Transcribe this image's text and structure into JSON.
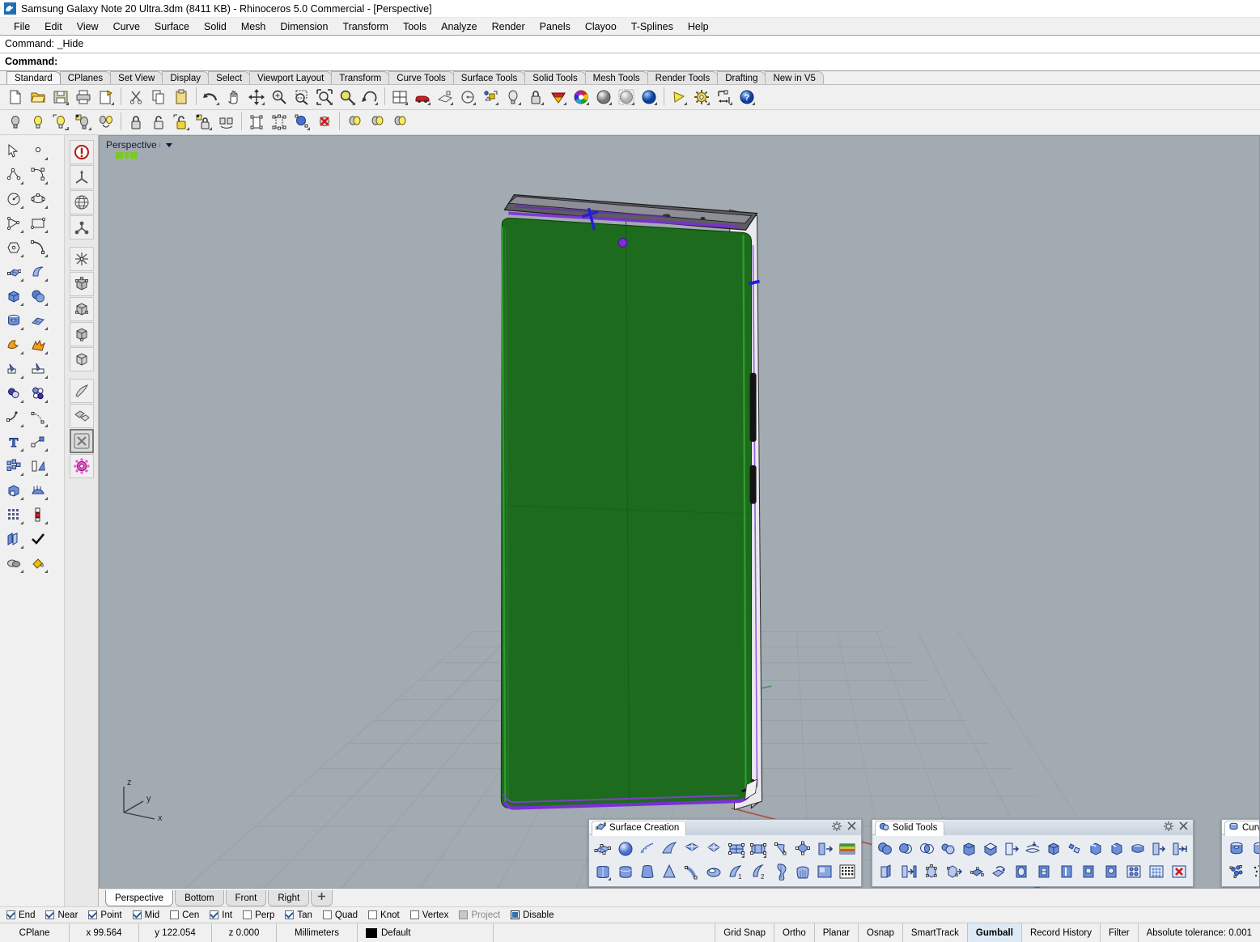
{
  "window": {
    "title": "Samsung Galaxy Note 20 Ultra.3dm (8411 KB) - Rhinoceros 5.0 Commercial - [Perspective]",
    "icon": "rhino-app-icon"
  },
  "menubar": {
    "items": [
      {
        "label": "File"
      },
      {
        "label": "Edit"
      },
      {
        "label": "View"
      },
      {
        "label": "Curve"
      },
      {
        "label": "Surface"
      },
      {
        "label": "Solid"
      },
      {
        "label": "Mesh"
      },
      {
        "label": "Dimension"
      },
      {
        "label": "Transform"
      },
      {
        "label": "Tools"
      },
      {
        "label": "Analyze"
      },
      {
        "label": "Render"
      },
      {
        "label": "Panels"
      },
      {
        "label": "Clayoo"
      },
      {
        "label": "T-Splines"
      },
      {
        "label": "Help"
      }
    ]
  },
  "command": {
    "history": "Command: _Hide",
    "prompt": "Command:",
    "input_value": ""
  },
  "toolbar_tabs": {
    "active": "Standard",
    "items": [
      {
        "label": "Standard"
      },
      {
        "label": "CPlanes"
      },
      {
        "label": "Set View"
      },
      {
        "label": "Display"
      },
      {
        "label": "Select"
      },
      {
        "label": "Viewport Layout"
      },
      {
        "label": "Transform"
      },
      {
        "label": "Curve Tools"
      },
      {
        "label": "Surface Tools"
      },
      {
        "label": "Solid Tools"
      },
      {
        "label": "Mesh Tools"
      },
      {
        "label": "Render Tools"
      },
      {
        "label": "Drafting"
      },
      {
        "label": "New in V5"
      }
    ]
  },
  "standard_toolbar": {
    "buttons": [
      {
        "name": "new-file-icon"
      },
      {
        "name": "open-file-icon"
      },
      {
        "name": "save-file-icon"
      },
      {
        "name": "print-icon"
      },
      {
        "name": "copy-to-clipboard-icon"
      },
      {
        "name": "cut-icon"
      },
      {
        "name": "copy-icon"
      },
      {
        "name": "paste-icon"
      },
      {
        "name": "undo-icon"
      },
      {
        "name": "pan-hand-icon"
      },
      {
        "name": "move-icon"
      },
      {
        "name": "zoom-in-icon"
      },
      {
        "name": "zoom-window-icon"
      },
      {
        "name": "zoom-extents-icon"
      },
      {
        "name": "zoom-selected-icon"
      },
      {
        "name": "rotate-view-icon"
      },
      {
        "name": "four-viewport-icon"
      },
      {
        "name": "render-car-icon"
      },
      {
        "name": "shade-icon"
      },
      {
        "name": "circle-tool-icon"
      },
      {
        "name": "named-cplane-icon"
      },
      {
        "name": "layer-bulb-icon"
      },
      {
        "name": "lock-icon"
      },
      {
        "name": "layers-panel-icon"
      },
      {
        "name": "color-wheel-icon"
      },
      {
        "name": "shaded-sphere-icon"
      },
      {
        "name": "ghosted-sphere-icon"
      },
      {
        "name": "rendered-sphere-icon"
      },
      {
        "name": "light-cone-icon"
      },
      {
        "name": "options-gear-icon"
      },
      {
        "name": "dimension-icon"
      },
      {
        "name": "help-icon"
      }
    ]
  },
  "layer_toolbar": {
    "buttons": [
      {
        "name": "layer-off-icon"
      },
      {
        "name": "layer-on-icon"
      },
      {
        "name": "layer-on-selected-icon"
      },
      {
        "name": "layer-toggle-icon"
      },
      {
        "name": "layer-isolate-icon"
      },
      {
        "name": "lock-layer-icon"
      },
      {
        "name": "unlock-layer-icon"
      },
      {
        "name": "unlock-selected-icon"
      },
      {
        "name": "lock-toggle-icon"
      },
      {
        "name": "swap-lock-icon"
      },
      {
        "name": "select-objects-icon"
      },
      {
        "name": "select-points-icon"
      },
      {
        "name": "select-sublayer-icon"
      },
      {
        "name": "deselect-all-icon"
      },
      {
        "name": "light-a-icon"
      },
      {
        "name": "light-b-icon"
      },
      {
        "name": "light-c-icon"
      }
    ]
  },
  "left_sidebar": {
    "buttons": [
      {
        "name": "select-arrow-icon"
      },
      {
        "name": "point-object-icon"
      },
      {
        "name": "polyline-icon"
      },
      {
        "name": "control-point-curve-icon"
      },
      {
        "name": "circle-icon"
      },
      {
        "name": "ellipse-icon"
      },
      {
        "name": "polygon-icon"
      },
      {
        "name": "rectangle-icon"
      },
      {
        "name": "hexagon-icon"
      },
      {
        "name": "arc-icon"
      },
      {
        "name": "surface-from-points-icon"
      },
      {
        "name": "loft-surface-icon"
      },
      {
        "name": "box-icon"
      },
      {
        "name": "sphere-icon"
      },
      {
        "name": "cylinder-icon"
      },
      {
        "name": "planar-surface-icon"
      },
      {
        "name": "boolean-union-icon"
      },
      {
        "name": "explode-icon"
      },
      {
        "name": "trim-icon"
      },
      {
        "name": "split-icon"
      },
      {
        "name": "fillet-icon"
      },
      {
        "name": "chamfer-icon"
      },
      {
        "name": "offset-curve-icon"
      },
      {
        "name": "blend-curve-icon"
      },
      {
        "name": "text-object-icon"
      },
      {
        "name": "scale-icon"
      },
      {
        "name": "array-icon"
      },
      {
        "name": "mirror-icon"
      },
      {
        "name": "extrude-icon"
      },
      {
        "name": "sweep-icon"
      },
      {
        "name": "rectangular-array-icon"
      },
      {
        "name": "polar-array-icon"
      },
      {
        "name": "copy-object-icon"
      },
      {
        "name": "check-object-icon"
      },
      {
        "name": "boolean-difference-icon"
      },
      {
        "name": "paint-bucket-icon"
      }
    ]
  },
  "second_sidebar": {
    "groups": [
      {
        "buttons": [
          {
            "name": "tspline-convert-icon"
          },
          {
            "name": "tspline-axis-icon"
          },
          {
            "name": "tspline-globe-icon"
          },
          {
            "name": "tspline-node-icon"
          }
        ]
      },
      {
        "buttons": [
          {
            "name": "tspline-symmetry-icon"
          },
          {
            "name": "tspline-box-a-icon"
          },
          {
            "name": "tspline-box-b-icon"
          },
          {
            "name": "tspline-box-c-icon"
          },
          {
            "name": "tspline-box-d-icon"
          }
        ]
      },
      {
        "buttons": [
          {
            "name": "tspline-pull-icon"
          },
          {
            "name": "tspline-bridge-icon"
          },
          {
            "name": "tspline-toggle-box-icon"
          },
          {
            "name": "clayoo-gear-icon"
          }
        ]
      }
    ]
  },
  "viewport": {
    "label": "Perspective",
    "dropdown_icon": "chevron-down-icon",
    "background_color": "#a2aab2",
    "grid_color": "#9aa2aa",
    "axis_x_color": "#c0392b",
    "axis_y_color": "#2e8b3f",
    "axes": {
      "x": "x",
      "y": "y",
      "z": "z"
    },
    "model": {
      "name": "samsung-galaxy-note-20-ultra-model",
      "screen_color": "#1d6b1d",
      "edge_highlight_color": "#7b2fd4",
      "frame_color": "#e9e9ee",
      "selected_edge_color": "#2020d8"
    }
  },
  "viewport_tabs": {
    "active": "Perspective",
    "items": [
      {
        "label": "Perspective"
      },
      {
        "label": "Bottom"
      },
      {
        "label": "Front"
      },
      {
        "label": "Right"
      }
    ],
    "add_label": "+"
  },
  "float_panels": [
    {
      "name": "surface-creation-panel",
      "title": "Surface Creation",
      "icon": "surface-panel-icon",
      "gear_icon": "gear-icon",
      "close_icon": "close-icon",
      "rows": [
        [
          {
            "name": "surface-from-points-icon"
          },
          {
            "name": "sphere-surface-icon"
          },
          {
            "name": "surface-from-curves-icon"
          },
          {
            "name": "patch-surface-icon"
          },
          {
            "name": "surface-from-planar-curves-icon"
          },
          {
            "name": "corner-points-surface-icon"
          },
          {
            "name": "edge-curves-2-icon"
          },
          {
            "name": "edge-curves-3-icon"
          },
          {
            "name": "surface-network-icon"
          },
          {
            "name": "curve-network-icon"
          },
          {
            "name": "extrude-surface-icon"
          },
          {
            "name": "heightfield-icon"
          }
        ],
        [
          {
            "name": "extrude-straight-icon"
          },
          {
            "name": "extrude-tapered-icon"
          },
          {
            "name": "extrude-to-point-icon"
          },
          {
            "name": "extrude-cone-icon"
          },
          {
            "name": "extrude-along-curve-icon"
          },
          {
            "name": "revolve-icon"
          },
          {
            "name": "sweep-1-rail-icon"
          },
          {
            "name": "sweep-2-rail-icon"
          },
          {
            "name": "rail-revolve-icon"
          },
          {
            "name": "loft-icon"
          },
          {
            "name": "surface-from-mesh-icon"
          },
          {
            "name": "point-grid-surface-icon"
          }
        ]
      ]
    },
    {
      "name": "solid-tools-panel",
      "title": "Solid Tools",
      "icon": "solid-panel-icon",
      "gear_icon": "gear-icon",
      "close_icon": "close-icon",
      "rows": [
        [
          {
            "name": "boolean-union-icon"
          },
          {
            "name": "boolean-difference-icon"
          },
          {
            "name": "boolean-intersection-icon"
          },
          {
            "name": "boolean-split-icon"
          },
          {
            "name": "boolean-two-objects-icon"
          },
          {
            "name": "cap-planar-holes-icon"
          },
          {
            "name": "extract-surface-icon"
          },
          {
            "name": "unroll-surface-icon"
          },
          {
            "name": "solid-box-icon"
          },
          {
            "name": "merge-faces-icon"
          },
          {
            "name": "fillet-edge-icon"
          },
          {
            "name": "chamfer-edge-icon"
          },
          {
            "name": "variable-fillet-icon"
          },
          {
            "name": "offset-solid-icon"
          },
          {
            "name": "shell-solid-icon"
          }
        ],
        [
          {
            "name": "solid-shell-icon"
          },
          {
            "name": "extract-wireframe-icon"
          },
          {
            "name": "edit-solid-points-icon"
          },
          {
            "name": "move-face-icon"
          },
          {
            "name": "move-edge-icon"
          },
          {
            "name": "rotate-face-icon"
          },
          {
            "name": "split-face-icon"
          },
          {
            "name": "merge-face-icon"
          },
          {
            "name": "fold-face-icon"
          },
          {
            "name": "hole-in-face-icon"
          },
          {
            "name": "round-hole-icon"
          },
          {
            "name": "array-holes-icon"
          },
          {
            "name": "grid-holes-icon"
          },
          {
            "name": "delete-hole-icon"
          }
        ]
      ]
    },
    {
      "name": "curve-tools-panel",
      "title": "Curv",
      "icon": "curve-panel-icon",
      "rows": [
        [
          {
            "name": "cylinder-a-icon"
          },
          {
            "name": "cylinder-b-icon"
          }
        ],
        [
          {
            "name": "point-cloud-icon"
          },
          {
            "name": "scatter-points-icon"
          }
        ]
      ]
    }
  ],
  "osnap": {
    "items": [
      {
        "label": "End",
        "checked": true,
        "state": "on"
      },
      {
        "label": "Near",
        "checked": true,
        "state": "on"
      },
      {
        "label": "Point",
        "checked": true,
        "state": "on"
      },
      {
        "label": "Mid",
        "checked": true,
        "state": "on"
      },
      {
        "label": "Cen",
        "checked": false,
        "state": "off"
      },
      {
        "label": "Int",
        "checked": true,
        "state": "on"
      },
      {
        "label": "Perp",
        "checked": false,
        "state": "off"
      },
      {
        "label": "Tan",
        "checked": true,
        "state": "on"
      },
      {
        "label": "Quad",
        "checked": false,
        "state": "off"
      },
      {
        "label": "Knot",
        "checked": false,
        "state": "off"
      },
      {
        "label": "Vertex",
        "checked": false,
        "state": "off"
      },
      {
        "label": "Project",
        "checked": false,
        "state": "disabled"
      },
      {
        "label": "Disable",
        "checked": false,
        "state": "highlight"
      }
    ]
  },
  "statusbar": {
    "cplane": "CPlane",
    "x": "x 99.564",
    "y": "y 122.054",
    "z": "z 0.000",
    "units": "Millimeters",
    "layer": "Default",
    "layer_color": "#000000",
    "toggles": [
      {
        "label": "Grid Snap",
        "active": false
      },
      {
        "label": "Ortho",
        "active": false
      },
      {
        "label": "Planar",
        "active": false
      },
      {
        "label": "Osnap",
        "active": false
      },
      {
        "label": "SmartTrack",
        "active": false
      },
      {
        "label": "Gumball",
        "active": true
      },
      {
        "label": "Record History",
        "active": false
      },
      {
        "label": "Filter",
        "active": false
      }
    ],
    "tolerance": "Absolute tolerance: 0.001"
  }
}
